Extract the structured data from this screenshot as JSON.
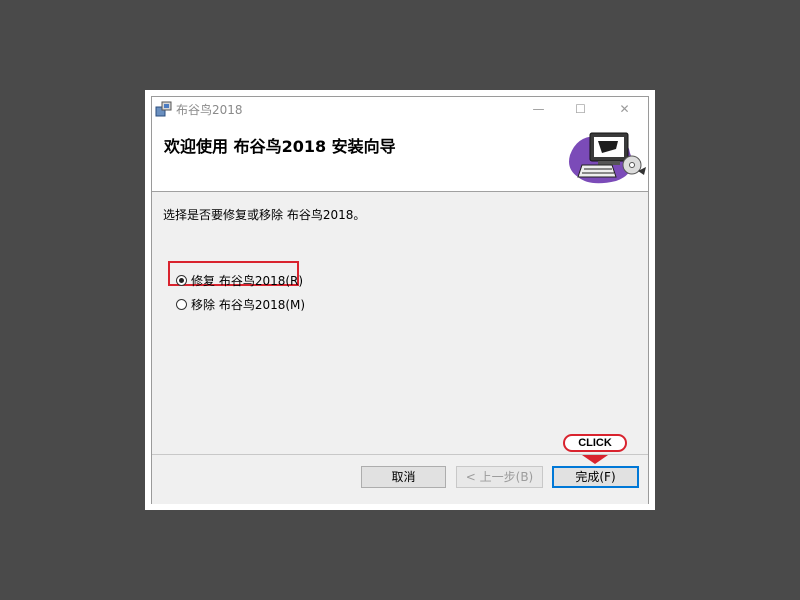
{
  "window": {
    "title": "布谷鸟2018",
    "minimize_glyph": "—",
    "maximize_glyph": "☐",
    "close_glyph": "✕"
  },
  "header": {
    "title": "欢迎使用 布谷鸟2018 安装向导",
    "art_icon": "computer-cd-icon"
  },
  "body": {
    "prompt": "选择是否要修复或移除 布谷鸟2018。",
    "options": [
      {
        "label": "修复 布谷鸟2018(R)",
        "selected": true
      },
      {
        "label": "移除 布谷鸟2018(M)",
        "selected": false
      }
    ]
  },
  "buttons": {
    "cancel": "取消",
    "back": "< 上一步(B)",
    "finish": "完成(F)"
  },
  "annotation": {
    "callout": "CLICK",
    "color": "#d9232e"
  },
  "colors": {
    "backdrop": "#4a4a4a",
    "focus_border": "#0078d7"
  }
}
